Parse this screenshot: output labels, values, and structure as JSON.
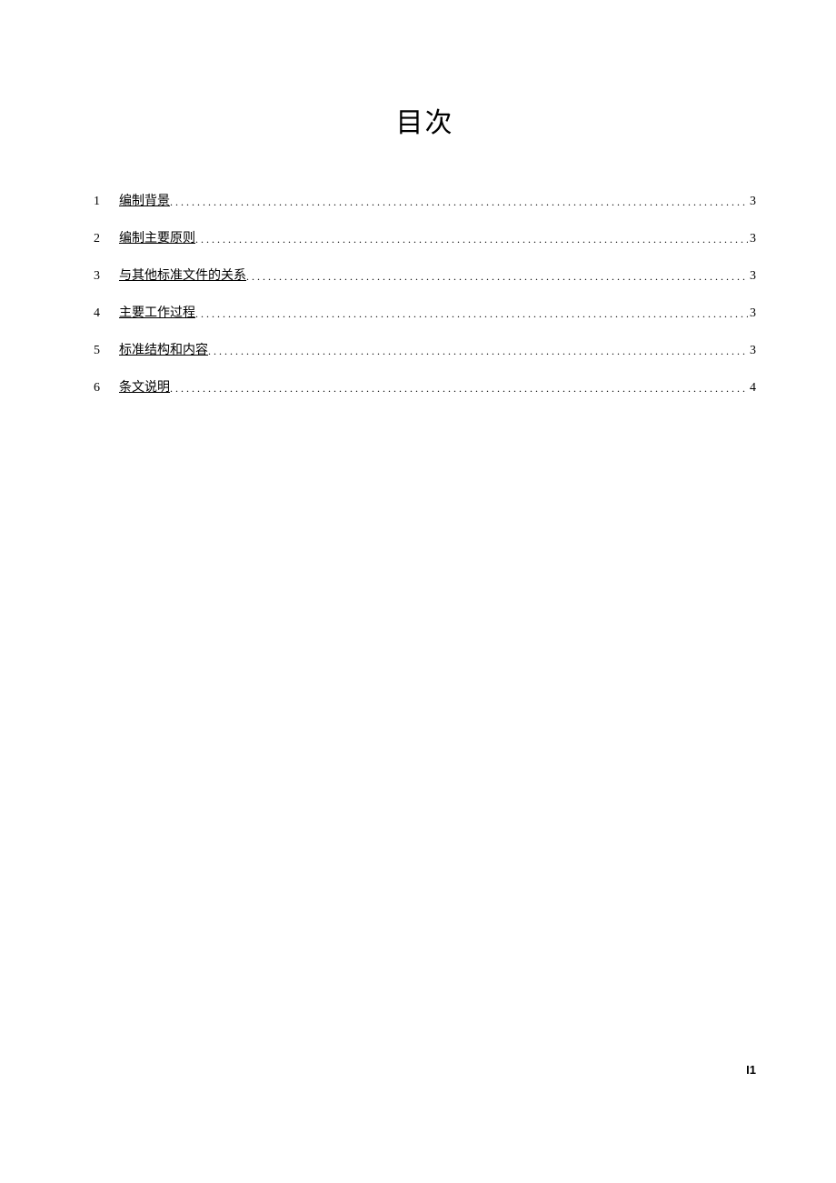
{
  "title": "目次",
  "toc": [
    {
      "number": "1",
      "label": "编制背景",
      "page": "3"
    },
    {
      "number": "2",
      "label": "编制主要原则",
      "page": "3"
    },
    {
      "number": "3",
      "label": "与其他标准文件的关系",
      "page": "3"
    },
    {
      "number": "4",
      "label": "主要工作过程",
      "page": "3"
    },
    {
      "number": "5",
      "label": "标准结构和内容",
      "page": "3"
    },
    {
      "number": "6",
      "label": "条文说明",
      "page": "4"
    }
  ],
  "footer": "I1"
}
